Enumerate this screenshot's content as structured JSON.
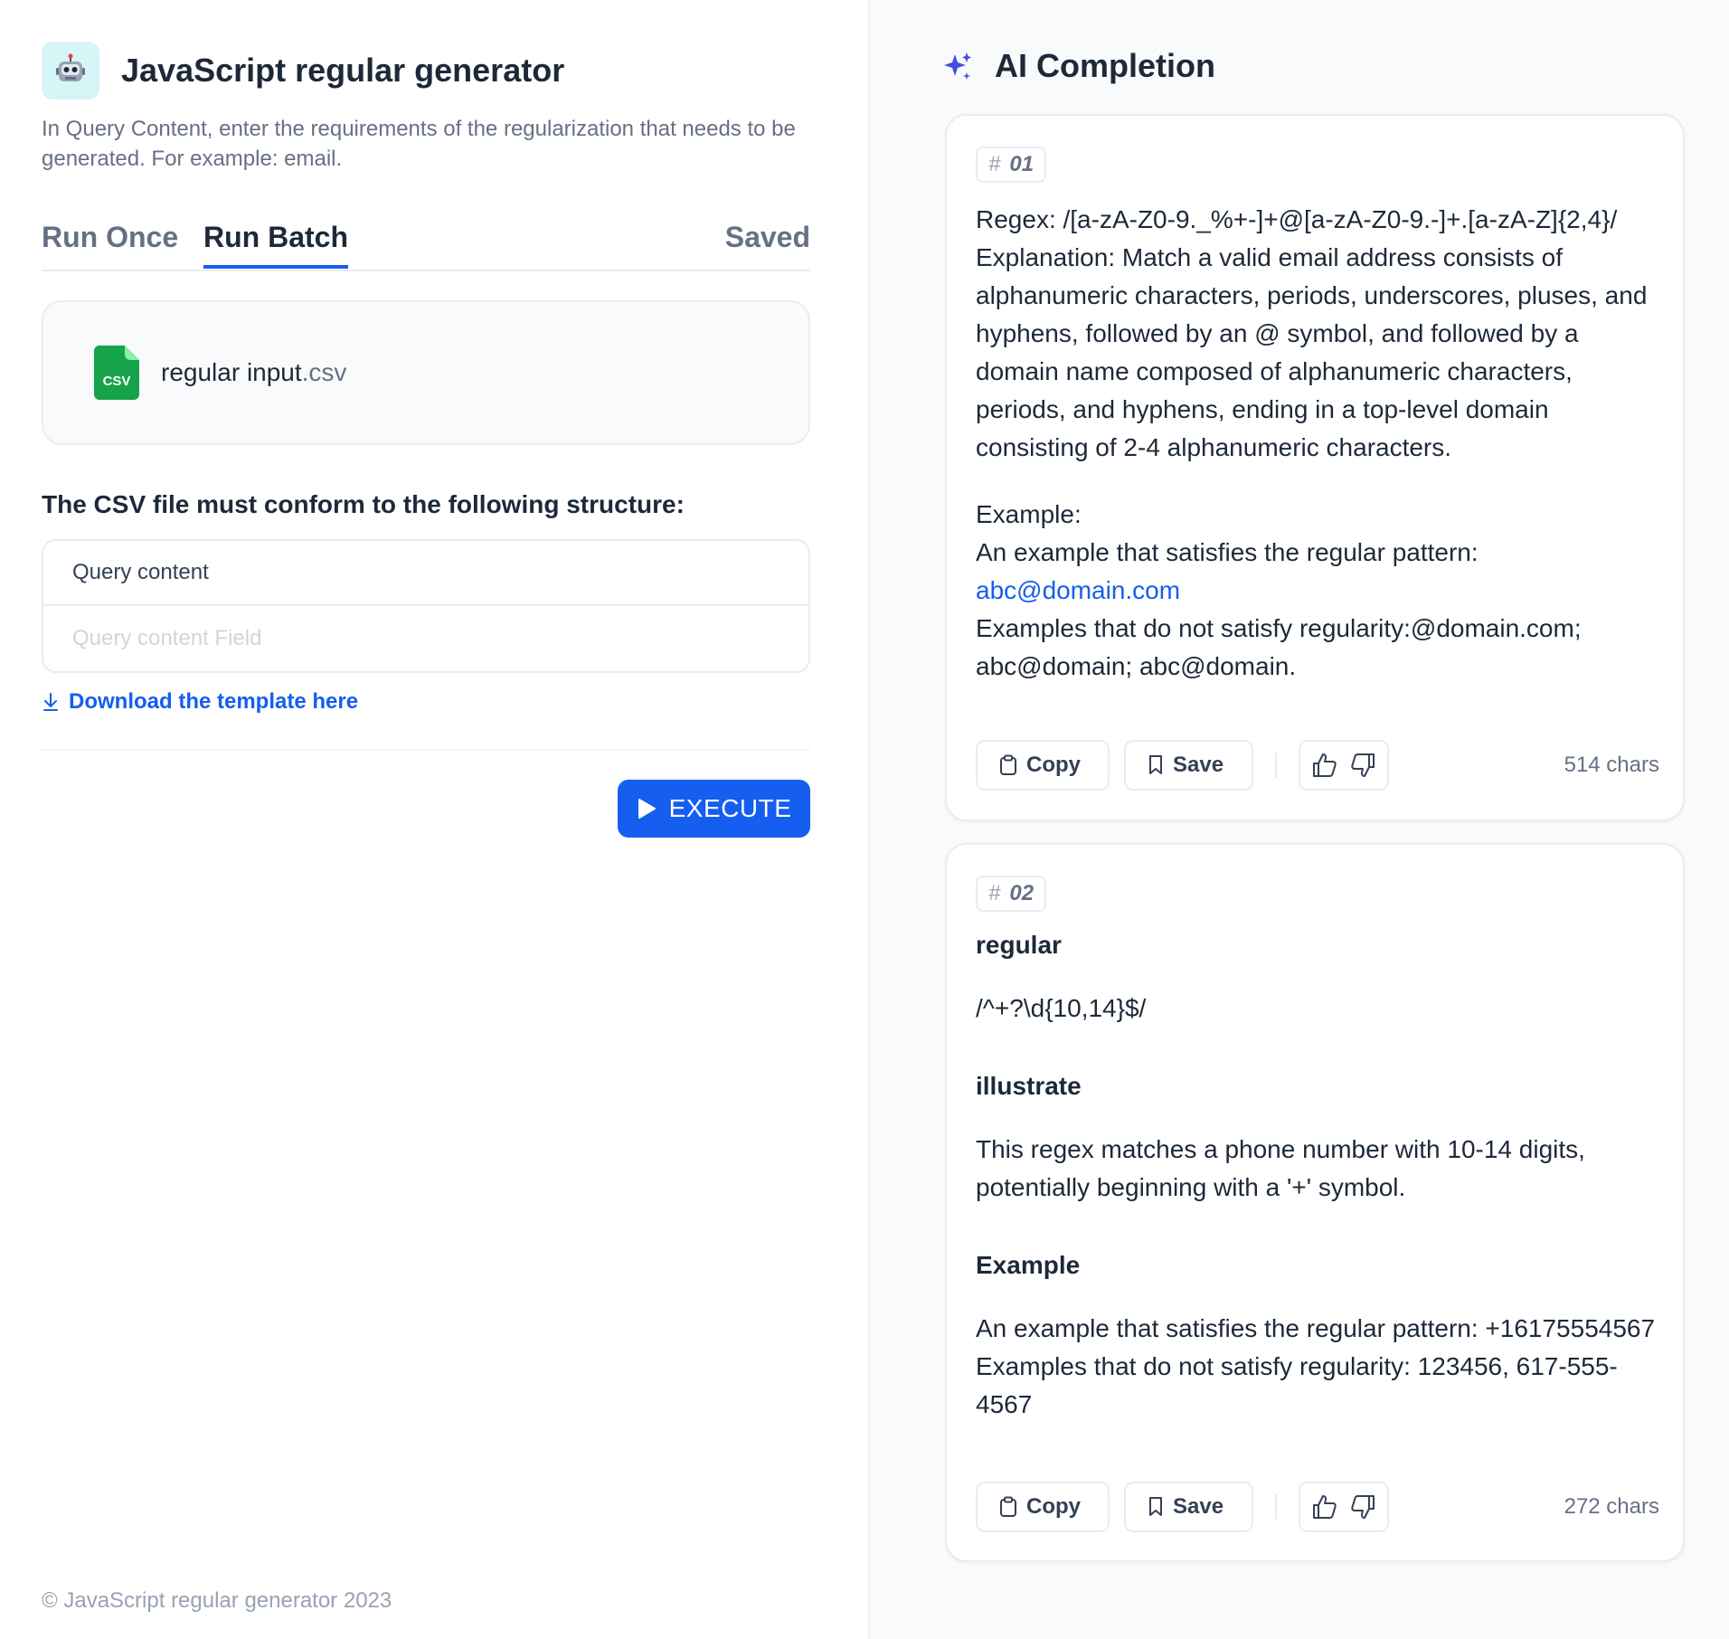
{
  "app": {
    "title": "JavaScript regular generator",
    "description": "In Query Content, enter the requirements of the regularization that needs to be generated. For example: email.",
    "icon": "robot-icon"
  },
  "tabs": {
    "run_once": "Run Once",
    "run_batch": "Run Batch",
    "saved": "Saved",
    "active": "Run Batch"
  },
  "file": {
    "name": "regular input",
    "ext": ".csv",
    "icon_label": "CSV",
    "icon_color": "#16a34a"
  },
  "structure": {
    "title": "The CSV file must conform to the following structure:",
    "header": "Query content",
    "placeholder": "Query content Field"
  },
  "download": {
    "label": "Download the template here"
  },
  "execute": {
    "label": "EXECUTE"
  },
  "footer": {
    "text": "© JavaScript regular generator 2023"
  },
  "ai": {
    "title": "AI Completion",
    "accent": "#444ce7"
  },
  "results": [
    {
      "index": "01",
      "regex_line": "Regex: /[a-zA-Z0-9._%+-]+@[a-zA-Z0-9.-]+.[a-zA-Z]{2,4}/",
      "explanation": "Explanation: Match a valid email address consists of alphanumeric characters, periods, underscores, pluses, and hyphens, followed by an @ symbol, and followed by a domain name composed of alphanumeric characters, periods, and hyphens, ending in a top-level domain consisting of 2-4 alphanumeric characters.",
      "example_head": "Example:",
      "example_intro": "An example that satisfies the regular pattern:",
      "example_link": "abc@domain.com",
      "example_bad": "Examples that do not satisfy regularity:@domain.com; abc@domain; abc@domain.",
      "chars": "514 chars"
    },
    {
      "index": "02",
      "h_regular": "regular",
      "regex": "/^+?\\d{10,14}$/",
      "h_illustrate": "illustrate",
      "illustrate": "This regex matches a phone number with 10-14 digits, potentially beginning with a '+' symbol.",
      "h_example": "Example",
      "example_good": "An example that satisfies the regular pattern: +16175554567",
      "example_bad": "Examples that do not satisfy regularity: 123456, 617-555-4567",
      "chars": "272 chars"
    }
  ],
  "actions": {
    "copy": "Copy",
    "save": "Save"
  }
}
